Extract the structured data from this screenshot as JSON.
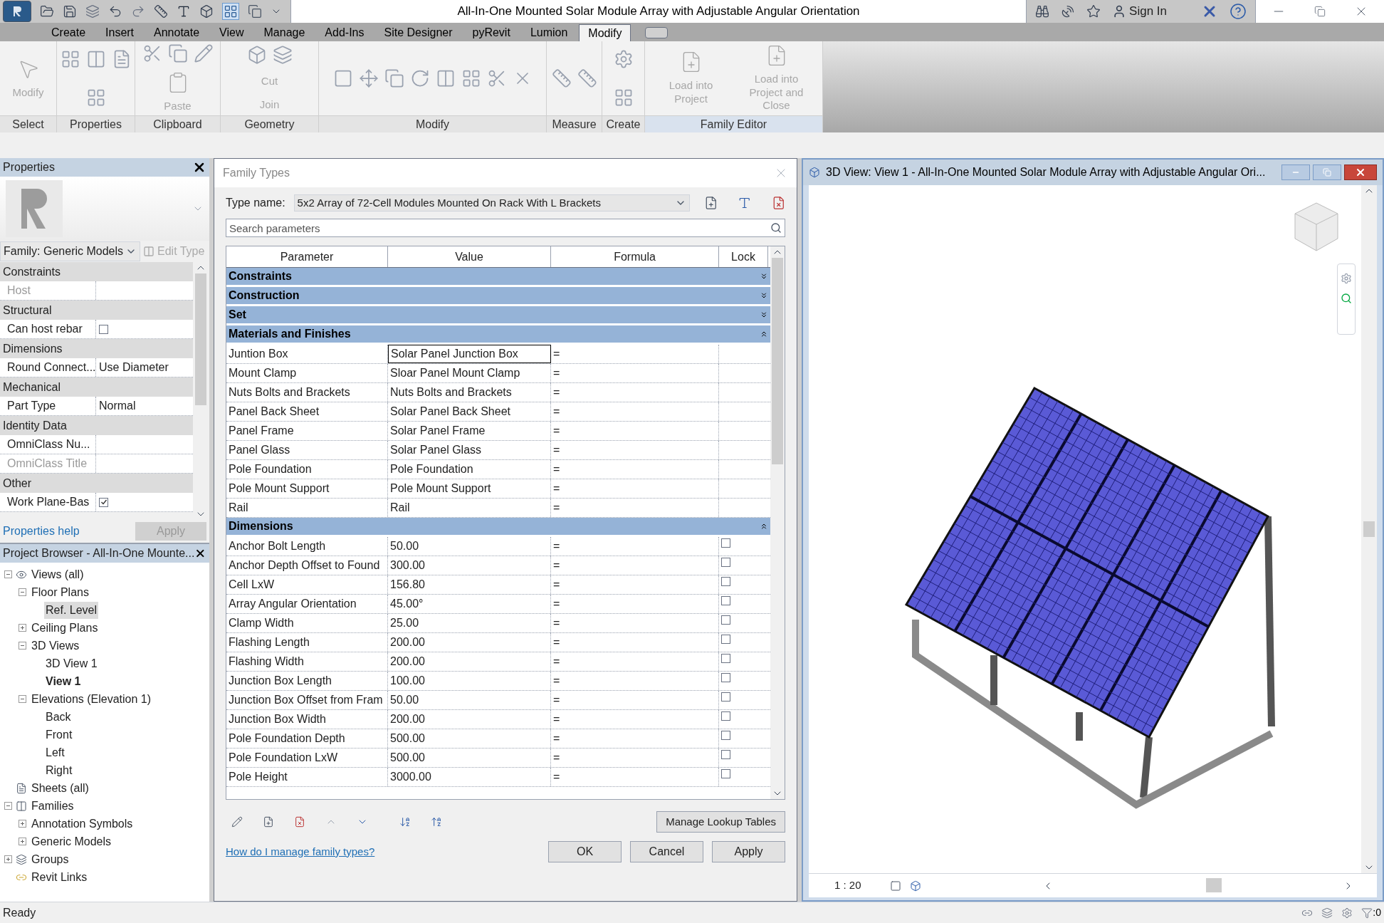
{
  "window": {
    "title": "All-In-One Mounted Solar Module Array with Adjustable Angular Orientation",
    "sign_in": "Sign In"
  },
  "ribbon": {
    "tabs": [
      {
        "label": "Create",
        "selected": false
      },
      {
        "label": "Insert",
        "selected": false
      },
      {
        "label": "Annotate",
        "selected": false
      },
      {
        "label": "View",
        "selected": false
      },
      {
        "label": "Manage",
        "selected": false
      },
      {
        "label": "Add-Ins",
        "selected": false
      },
      {
        "label": "Site Designer",
        "selected": false
      },
      {
        "label": "pyRevit",
        "selected": false
      },
      {
        "label": "Lumion",
        "selected": false
      },
      {
        "label": "Modify",
        "selected": true
      }
    ],
    "panels": [
      {
        "kind": "select",
        "label": "Select",
        "tools": [
          {
            "label": "Modify",
            "disabled": true
          }
        ]
      },
      {
        "kind": "properties",
        "label": "Properties"
      },
      {
        "kind": "clipboard",
        "label": "Clipboard",
        "tools": [
          {
            "label": "Paste",
            "disabled": true
          }
        ]
      },
      {
        "kind": "geometry",
        "label": "Geometry",
        "tools": [
          {
            "label": "Cut",
            "disabled": true
          },
          {
            "label": "Join",
            "disabled": true
          }
        ]
      },
      {
        "kind": "modify",
        "label": "Modify"
      },
      {
        "kind": "measure",
        "label": "Measure"
      },
      {
        "kind": "create",
        "label": "Create"
      },
      {
        "kind": "family",
        "label": "Family Editor",
        "tools": [
          {
            "label": "Load into Project",
            "disabled": true
          },
          {
            "label": "Load into Project and Close",
            "disabled": true
          }
        ]
      }
    ]
  },
  "properties": {
    "title": "Properties",
    "family": "Family: Generic Models",
    "edit_type": "Edit Type",
    "help": "Properties help",
    "apply": "Apply",
    "sections": [
      {
        "label": "Constraints",
        "rows": [
          {
            "name": "Host",
            "disabled": true
          }
        ]
      },
      {
        "label": "Structural",
        "rows": [
          {
            "name": "Can host rebar",
            "disabled": false,
            "kind": "checkbox",
            "checked": false
          }
        ]
      },
      {
        "label": "Dimensions",
        "rows": [
          {
            "name": "Round Connect...",
            "disabled": false,
            "value": "Use Diameter"
          }
        ]
      },
      {
        "label": "Mechanical",
        "rows": [
          {
            "name": "Part Type",
            "disabled": false,
            "value": "Normal"
          }
        ]
      },
      {
        "label": "Identity Data",
        "rows": [
          {
            "name": "OmniClass Nu...",
            "disabled": false
          },
          {
            "name": "OmniClass Title",
            "disabled": true
          }
        ]
      },
      {
        "label": "Other",
        "rows": [
          {
            "name": "Work Plane-Bas",
            "disabled": false,
            "kind": "checkbox",
            "checked": true
          }
        ]
      }
    ]
  },
  "project_browser": {
    "title": "Project Browser - All-In-One Mounte...",
    "tree": [
      {
        "label": "Views (all)",
        "kind": "views",
        "expanded": true,
        "children": [
          {
            "label": "Floor Plans",
            "expanded": true,
            "children": [
              {
                "label": "Ref. Level",
                "selected": true,
                "current": false
              }
            ]
          },
          {
            "label": "Ceiling Plans",
            "expanded": false
          },
          {
            "label": "3D Views",
            "expanded": true,
            "children": [
              {
                "label": "3D View 1",
                "selected": false,
                "current": false
              },
              {
                "label": "View 1",
                "selected": false,
                "current": true
              }
            ]
          },
          {
            "label": "Elevations (Elevation 1)",
            "expanded": true,
            "children": [
              {
                "label": "Back",
                "selected": false,
                "current": false
              },
              {
                "label": "Front",
                "selected": false,
                "current": false
              },
              {
                "label": "Left",
                "selected": false,
                "current": false
              },
              {
                "label": "Right",
                "selected": false,
                "current": false
              }
            ]
          }
        ]
      },
      {
        "label": "Sheets (all)",
        "kind": "sheets"
      },
      {
        "label": "Families",
        "kind": "families",
        "expanded": true,
        "children": [
          {
            "label": "Annotation Symbols",
            "expanded": false
          },
          {
            "label": "Generic Models",
            "expanded": false
          }
        ]
      },
      {
        "label": "Groups",
        "kind": "groups",
        "expanded": false
      },
      {
        "label": "Revit Links",
        "kind": "links"
      }
    ]
  },
  "dialog": {
    "title": "Family Types",
    "type_name_label": "Type name:",
    "type_name": "5x2 Array of 72-Cell Modules Mounted On Rack With L Brackets",
    "search_placeholder": "Search parameters",
    "columns": [
      "Parameter",
      "Value",
      "Formula",
      "Lock"
    ],
    "groups": [
      {
        "label": "Constraints",
        "expanded": false
      },
      {
        "label": "Construction",
        "expanded": false
      },
      {
        "label": "Set",
        "expanded": false
      },
      {
        "label": "Materials and Finishes",
        "expanded": true,
        "rows": [
          {
            "parameter": "Juntion Box",
            "value": "Solar Panel Junction Box",
            "formula": "=",
            "selected": true
          },
          {
            "parameter": "Mount Clamp",
            "value": "Sloar Panel Mount Clamp",
            "formula": "=",
            "selected": false
          },
          {
            "parameter": "Nuts Bolts and Brackets",
            "value": "Nuts Bolts and Brackets",
            "formula": "=",
            "selected": false
          },
          {
            "parameter": "Panel Back Sheet",
            "value": "Solar Panel Back Sheet",
            "formula": "=",
            "selected": false
          },
          {
            "parameter": "Panel Frame",
            "value": "Solar Panel Frame",
            "formula": "=",
            "selected": false
          },
          {
            "parameter": "Panel Glass",
            "value": "Solar Panel Glass",
            "formula": "=",
            "selected": false
          },
          {
            "parameter": "Pole Foundation",
            "value": "Pole Foundation",
            "formula": "=",
            "selected": false
          },
          {
            "parameter": "Pole Mount Support",
            "value": "Pole Mount Support",
            "formula": "=",
            "selected": false
          },
          {
            "parameter": "Rail",
            "value": "Rail",
            "formula": "=",
            "selected": false
          }
        ]
      },
      {
        "label": "Dimensions",
        "expanded": true,
        "rows": [
          {
            "parameter": "Anchor Bolt Length",
            "value": "50.00",
            "formula": "=",
            "selected": false,
            "lock": false
          },
          {
            "parameter": "Anchor Depth Offset to Found",
            "value": "300.00",
            "formula": "=",
            "selected": false,
            "lock": false
          },
          {
            "parameter": "Cell LxW",
            "value": "156.80",
            "formula": "=",
            "selected": false,
            "lock": false
          },
          {
            "parameter": "Array Angular Orientation",
            "value": "45.00°",
            "formula": "=",
            "selected": false,
            "lock": false
          },
          {
            "parameter": "Clamp Width",
            "value": "25.00",
            "formula": "=",
            "selected": false,
            "lock": false
          },
          {
            "parameter": "Flashing Length",
            "value": "200.00",
            "formula": "=",
            "selected": false,
            "lock": false
          },
          {
            "parameter": "Flashing Width",
            "value": "200.00",
            "formula": "=",
            "selected": false,
            "lock": false
          },
          {
            "parameter": "Junction Box Length",
            "value": "100.00",
            "formula": "=",
            "selected": false,
            "lock": false
          },
          {
            "parameter": "Junction Box Offset from Fram",
            "value": "50.00",
            "formula": "=",
            "selected": false,
            "lock": false
          },
          {
            "parameter": "Junction Box Width",
            "value": "200.00",
            "formula": "=",
            "selected": false,
            "lock": false
          },
          {
            "parameter": "Pole Foundation Depth",
            "value": "500.00",
            "formula": "=",
            "selected": false,
            "lock": false
          },
          {
            "parameter": "Pole Foundation LxW",
            "value": "500.00",
            "formula": "=",
            "selected": false,
            "lock": false
          },
          {
            "parameter": "Pole Height",
            "value": "3000.00",
            "formula": "=",
            "selected": false,
            "lock": false
          }
        ]
      }
    ],
    "lookup_button": "Manage Lookup Tables",
    "help_link": "How do I manage family types?",
    "buttons": [
      "OK",
      "Cancel",
      "Apply"
    ]
  },
  "view": {
    "title": "3D View: View 1 - All-In-One Mounted Solar Module Array with Adjustable Angular Ori...",
    "scale": "1 : 20"
  },
  "status_bar": {
    "text": "Ready",
    "filter_count": ":0"
  }
}
